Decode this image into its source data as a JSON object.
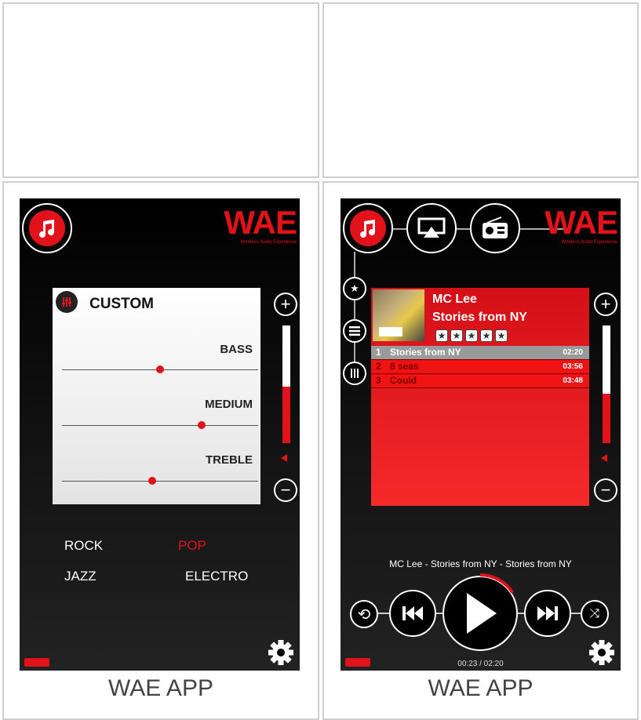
{
  "captions": [
    "WAE APP",
    "WAE APP"
  ],
  "logo": {
    "text": "WAE",
    "tagline": "Wireless Audio Experience"
  },
  "icons": {
    "music": "music-note-icon",
    "airplay": "airplay-icon",
    "radio": "radio-icon",
    "settings": "gear-icon",
    "battery": "battery-icon",
    "volume": "speaker-icon",
    "eq": "equalizer-icon"
  },
  "equalizer": {
    "title": "CUSTOM",
    "bands": [
      {
        "label": "BASS",
        "value": 0.5
      },
      {
        "label": "MEDIUM",
        "value": 0.71
      },
      {
        "label": "TREBLE",
        "value": 0.46
      }
    ],
    "presets": [
      "ROCK",
      "POP",
      "JAZZ",
      "ELECTRO"
    ],
    "active_preset": "POP",
    "volume": 0.48
  },
  "player": {
    "artist": "MC Lee",
    "album": "Stories from NY",
    "rating": 5,
    "tracks": [
      {
        "num": "1",
        "title": "Stories from NY",
        "duration": "02:20"
      },
      {
        "num": "2",
        "title": "8 seas",
        "duration": "03:56"
      },
      {
        "num": "3",
        "title": "Could",
        "duration": "03:48"
      }
    ],
    "now_playing": "MC Lee - Stories from NY - Stories from NY",
    "elapsed": "00:23 / 02:20",
    "volume": 0.42,
    "progress": 0.16
  },
  "colors": {
    "accent": "#e1121a",
    "background": "#000000"
  }
}
